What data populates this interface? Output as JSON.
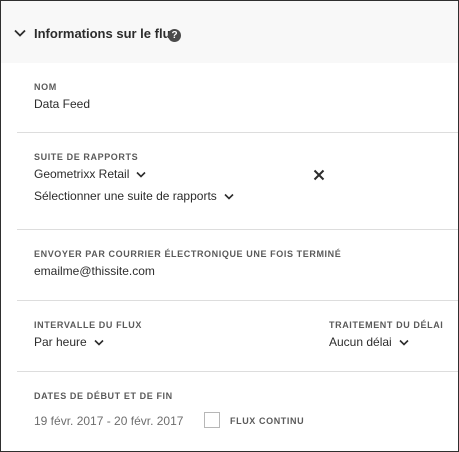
{
  "header": {
    "title": "Informations sur le flux",
    "help_glyph": "?"
  },
  "fields": {
    "name": {
      "label": "NOM",
      "value": "Data Feed"
    },
    "report_suite": {
      "label": "SUITE DE RAPPORTS",
      "selected": "Geometrixx Retail",
      "placeholder": "Sélectionner une suite de rapports"
    },
    "email": {
      "label": "ENVOYER PAR COURRIER ÉLECTRONIQUE UNE FOIS TERMINÉ",
      "value": "emailme@thissite.com"
    },
    "interval": {
      "label": "INTERVALLE DU FLUX",
      "value": "Par heure"
    },
    "delay": {
      "label": "TRAITEMENT DU DÉLAI",
      "value": "Aucun délai"
    },
    "dates": {
      "label": "DATES DE DÉBUT ET DE FIN",
      "value": "19 févr. 2017 - 20 févr. 2017",
      "continuous_label": "FLUX CONTINU",
      "continuous_checked": false
    }
  },
  "icons": {
    "collapse": "chevron-down-icon",
    "help": "help-icon",
    "dropdown": "chevron-down-icon",
    "remove": "close-icon"
  },
  "colors": {
    "header_bg": "#f8f8f8",
    "text": "#2c2c2c",
    "divider": "#dddddd",
    "help_icon_bg": "#4b4b4b"
  }
}
